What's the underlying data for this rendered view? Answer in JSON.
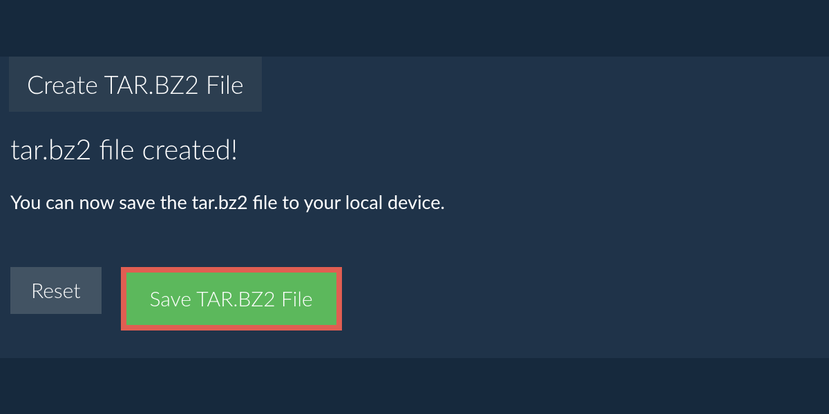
{
  "tab": {
    "label": "Create TAR.BZ2 File"
  },
  "status": {
    "heading": "tar.bz2 file created!",
    "subtext": "You can now save the tar.bz2 file to your local device."
  },
  "buttons": {
    "reset_label": "Reset",
    "save_label": "Save TAR.BZ2 File"
  }
}
